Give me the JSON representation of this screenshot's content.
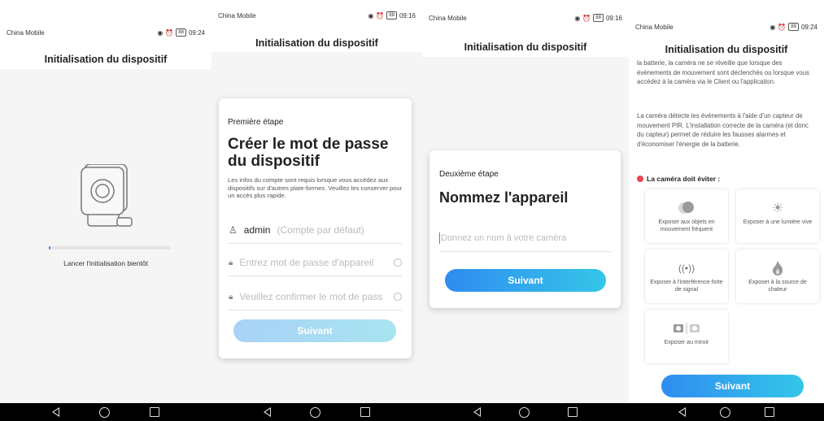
{
  "status_bar": {
    "carrier": "China Mobile",
    "times": [
      "09:24",
      "09:16",
      "09:16",
      "09:24"
    ],
    "battery": "88"
  },
  "screen1": {
    "title": "Initialisation du dispositif",
    "progress": 0.01,
    "caption": "Lancer l'initialisation bientôt"
  },
  "screen2": {
    "title": "Initialisation du dispositif",
    "step": "Première étape",
    "heading": "Créer le mot de passe du dispositif",
    "description": "Les infos du compte sont requis lorsque vous accédez aux dispositifs sur d'autres plate-formes. Veuillez les conserver pour un accès plus rapide.",
    "username_value": "admin",
    "username_hint": "(Compte par défaut)",
    "password_placeholder": "Entrez mot de passe d'appareil",
    "confirm_placeholder": "Veuillez confirmer le mot de pass",
    "button": "Suivant"
  },
  "screen3": {
    "title": "Initialisation du dispositif",
    "step": "Deuxième étape",
    "heading": "Nommez l'appareil",
    "name_placeholder": "Donnez un nom à votre caméra",
    "button": "Suivant"
  },
  "screen4": {
    "title": "Initialisation du dispositif",
    "para1": "la batterie, la caméra ne se réveille que lorsque des événements de mouvement sont déclenchés ou lorsque vous accédez à la caméra via le Client ou l'application.",
    "para2": "La caméra détecte les événements à l'aide d'un capteur de mouvement PIR. L'installation correcte de la caméra (et donc du capteur) permet de réduire les fausses alarmes et d'économiser l'énergie de la batterie.",
    "avoid_title": "La caméra doit éviter :",
    "hazards": [
      {
        "label": "Exposer aux objets en mouvement fréquent",
        "icon": "moving-objects-icon"
      },
      {
        "label": "Exposer à une lumière vive",
        "icon": "sun-icon"
      },
      {
        "label": "Exposer à l'interférence forte de signal",
        "icon": "signal-icon"
      },
      {
        "label": "Exposer à la source de chaleur",
        "icon": "flame-icon"
      },
      {
        "label": "Exposer au miroir",
        "icon": "mirror-icon"
      }
    ],
    "button": "Suivant"
  },
  "colors": {
    "accent_gradient_start": "#2f8cf0",
    "accent_gradient_end": "#34c6e8",
    "disabled_start": "#a8d2f7",
    "disabled_end": "#a8e4f0",
    "warning": "#e8474c"
  }
}
